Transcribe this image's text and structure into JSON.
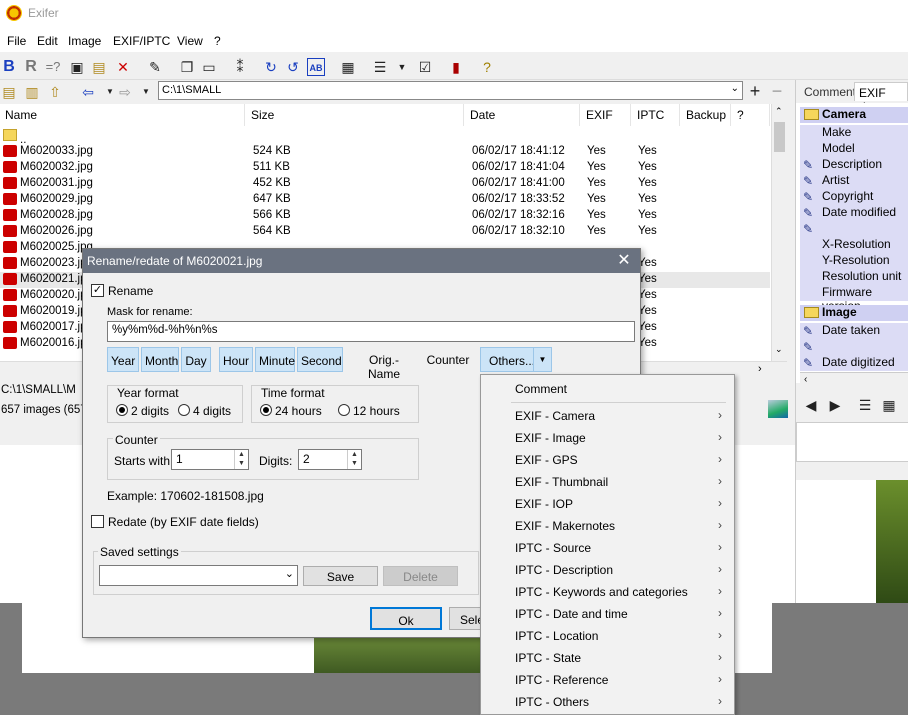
{
  "window": {
    "title": "Exifer"
  },
  "menu": [
    "File",
    "Edit",
    "Image",
    "EXIF/IPTC",
    "View",
    "?"
  ],
  "toolbar2": {
    "path": "C:\\1\\SMALL"
  },
  "filelist": {
    "headers": [
      "Name",
      "Size",
      "Date",
      "EXIF",
      "IPTC",
      "Backup",
      "?"
    ],
    "parent": "..",
    "rows": [
      {
        "name": "M6020033.jpg",
        "size": "524 KB",
        "date": "06/02/17 18:41:12",
        "exif": "Yes",
        "iptc": "Yes"
      },
      {
        "name": "M6020032.jpg",
        "size": "511 KB",
        "date": "06/02/17 18:41:04",
        "exif": "Yes",
        "iptc": "Yes"
      },
      {
        "name": "M6020031.jpg",
        "size": "452 KB",
        "date": "06/02/17 18:41:00",
        "exif": "Yes",
        "iptc": "Yes"
      },
      {
        "name": "M6020029.jpg",
        "size": "647 KB",
        "date": "06/02/17 18:33:52",
        "exif": "Yes",
        "iptc": "Yes"
      },
      {
        "name": "M6020028.jpg",
        "size": "566 KB",
        "date": "06/02/17 18:32:16",
        "exif": "Yes",
        "iptc": "Yes"
      },
      {
        "name": "M6020026.jpg",
        "size": "564 KB",
        "date": "06/02/17 18:32:10",
        "exif": "Yes",
        "iptc": "Yes"
      },
      {
        "name": "M6020025.jpg",
        "size": "",
        "date": "",
        "exif": "",
        "iptc": ""
      },
      {
        "name": "M6020023.jp",
        "size": "",
        "date": "",
        "exif": "",
        "iptc": "Yes"
      },
      {
        "name": "M6020021.jp",
        "size": "",
        "date": "",
        "exif": "",
        "iptc": "Yes"
      },
      {
        "name": "M6020020.jp",
        "size": "",
        "date": "",
        "exif": "",
        "iptc": "Yes"
      },
      {
        "name": "M6020019.jp",
        "size": "",
        "date": "",
        "exif": "",
        "iptc": "Yes"
      },
      {
        "name": "M6020017.jp",
        "size": "",
        "date": "",
        "exif": "",
        "iptc": "Yes"
      },
      {
        "name": "M6020016.jp",
        "size": "",
        "date": "",
        "exif": "",
        "iptc": "Yes"
      }
    ]
  },
  "status": {
    "path": "C:\\1\\SMALL\\M",
    "count": "657 images (657"
  },
  "right_panel": {
    "tabs": [
      "Comment",
      "EXIF data"
    ],
    "camera_group": "Camera",
    "camera_items": [
      {
        "label": "Make",
        "editable": false
      },
      {
        "label": "Model",
        "editable": false
      },
      {
        "label": "Description",
        "editable": true
      },
      {
        "label": "Artist",
        "editable": true
      },
      {
        "label": "Copyright",
        "editable": true
      },
      {
        "label": "Date modified",
        "editable": true
      },
      {
        "label": "",
        "editable": true
      },
      {
        "label": "X-Resolution",
        "editable": false
      },
      {
        "label": "Y-Resolution",
        "editable": false
      },
      {
        "label": "Resolution unit",
        "editable": false
      },
      {
        "label": "Firmware version",
        "editable": false
      }
    ],
    "image_group": "Image",
    "image_items": [
      {
        "label": "Date taken",
        "editable": true
      },
      {
        "label": "",
        "editable": true
      },
      {
        "label": "Date digitized",
        "editable": true
      }
    ]
  },
  "dialog": {
    "title": "Rename/redate of M6020021.jpg",
    "rename_label": "Rename",
    "rename_checked": true,
    "mask_label": "Mask for rename:",
    "mask_value": "%y%m%d-%h%n%s",
    "mask_buttons": [
      "Year",
      "Month",
      "Day",
      "Hour",
      "Minute",
      "Second",
      "Orig.-Name",
      "Counter",
      "Others..."
    ],
    "year_format": {
      "label": "Year format",
      "opt1": "2 digits",
      "opt2": "4 digits",
      "selected": "2 digits"
    },
    "time_format": {
      "label": "Time format",
      "opt1": "24 hours",
      "opt2": "12 hours",
      "selected": "24 hours"
    },
    "counter": {
      "label": "Counter",
      "starts_label": "Starts with:",
      "starts_value": "1",
      "digits_label": "Digits:",
      "digits_value": "2"
    },
    "example": "Example:  170602-181508.jpg",
    "redate_label": "Redate (by EXIF date fields)",
    "redate_checked": false,
    "saved_settings": {
      "label": "Saved settings",
      "value": "",
      "save": "Save",
      "delete": "Delete"
    },
    "ok": "Ok",
    "select": "Sele"
  },
  "popup": {
    "items": [
      "Comment",
      "EXIF - Camera",
      "EXIF - Image",
      "EXIF - GPS",
      "EXIF - Thumbnail",
      "EXIF - IOP",
      "EXIF - Makernotes",
      "IPTC - Source",
      "IPTC - Description",
      "IPTC - Keywords and categories",
      "IPTC - Date and time",
      "IPTC - Location",
      "IPTC - State",
      "IPTC - Reference",
      "IPTC - Others"
    ]
  }
}
